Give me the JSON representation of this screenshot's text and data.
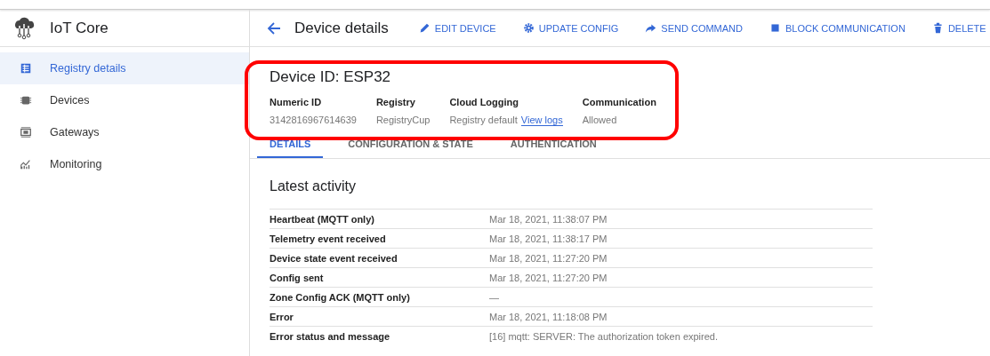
{
  "app": {
    "title": "IoT Core"
  },
  "sidebar": {
    "items": [
      {
        "label": "Registry details",
        "selected": true
      },
      {
        "label": "Devices",
        "selected": false
      },
      {
        "label": "Gateways",
        "selected": false
      },
      {
        "label": "Monitoring",
        "selected": false
      }
    ]
  },
  "header": {
    "title": "Device details",
    "actions": [
      {
        "label": "EDIT DEVICE"
      },
      {
        "label": "UPDATE CONFIG"
      },
      {
        "label": "SEND COMMAND"
      },
      {
        "label": "BLOCK COMMUNICATION"
      },
      {
        "label": "DELETE"
      }
    ]
  },
  "device": {
    "title": "Device ID: ESP32",
    "highlighted": true,
    "fields": [
      {
        "label": "Numeric ID",
        "value": "3142816967614639"
      },
      {
        "label": "Registry",
        "value": "RegistryCup"
      },
      {
        "label": "Cloud Logging",
        "value": "Registry default",
        "link": "View logs"
      },
      {
        "label": "Communication",
        "value": "Allowed"
      }
    ]
  },
  "tabs": [
    {
      "label": "DETAILS",
      "selected": true
    },
    {
      "label": "CONFIGURATION & STATE",
      "selected": false
    },
    {
      "label": "AUTHENTICATION",
      "selected": false
    }
  ],
  "activity": {
    "title": "Latest activity",
    "rows": [
      {
        "label": "Heartbeat (MQTT only)",
        "value": "Mar 18, 2021, 11:38:07 PM"
      },
      {
        "label": "Telemetry event received",
        "value": "Mar 18, 2021, 11:38:17 PM"
      },
      {
        "label": "Device state event received",
        "value": "Mar 18, 2021, 11:27:20 PM"
      },
      {
        "label": "Config sent",
        "value": "Mar 18, 2021, 11:27:20 PM"
      },
      {
        "label": "Zone Config ACK (MQTT only)",
        "value": "—"
      },
      {
        "label": "Error",
        "value": "Mar 18, 2021, 11:18:08 PM"
      },
      {
        "label": "Error status and message",
        "value": "[16] mqtt: SERVER: The authorization token expired."
      }
    ]
  }
}
